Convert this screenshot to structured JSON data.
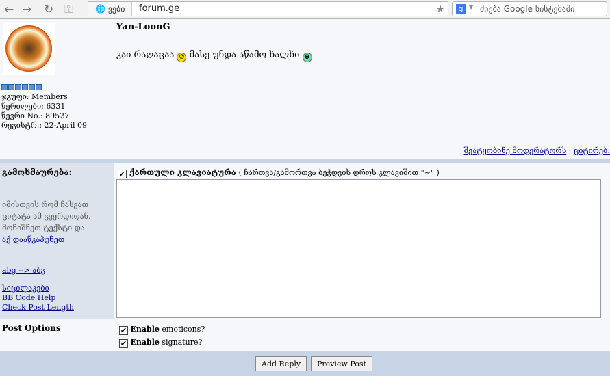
{
  "browser": {
    "back": "←",
    "forward": "→",
    "reload": "↻",
    "key": "⚿",
    "site_label": "ვები",
    "url": "forum.ge",
    "search_engine": "g",
    "search_placeholder": "ძიება Google სისტემაში"
  },
  "post": {
    "username": "Yan-LoonG",
    "message_part1": "კაი რაღაცაა",
    "message_part2": "მასე უნდა აწამო ხალხი",
    "pips": 6,
    "info": [
      "ჯგუფი: Members",
      "წერილები: 6331",
      "წევრი No.: 89527",
      "რეგისტრ.: 22-April 09"
    ],
    "report_link": "შეატყობინე მოდერატორს",
    "separator": "·",
    "quote_link": "ციტირებ:"
  },
  "reply": {
    "heading": "გამოხმაურება:",
    "hint": "იმისთვის რომ ჩასვათ ციტატა ამ გვერდიდან, მონიშნეთ ტექსტი და",
    "hint_link": "აქ დააწკაპუნეთ",
    "translit_link": "abg --> აბგ",
    "links": [
      "სიცილაკები",
      "BB Code Help",
      "Check Post Length"
    ],
    "keyboard_label": "ქართული კლავიატურა",
    "keyboard_note": "( ჩართვა/გამორთვა ბეჭდვის დროს კლავიშით \"~\" )",
    "keyboard_checked": true,
    "textarea_value": ""
  },
  "options": {
    "heading": "Post Options",
    "emoticons_bold": "Enable",
    "emoticons_rest": "emoticons?",
    "signature_bold": "Enable",
    "signature_rest": "signature?",
    "emoticons_checked": true,
    "signature_checked": true
  },
  "buttons": {
    "add_reply": "Add Reply",
    "preview": "Preview Post"
  }
}
